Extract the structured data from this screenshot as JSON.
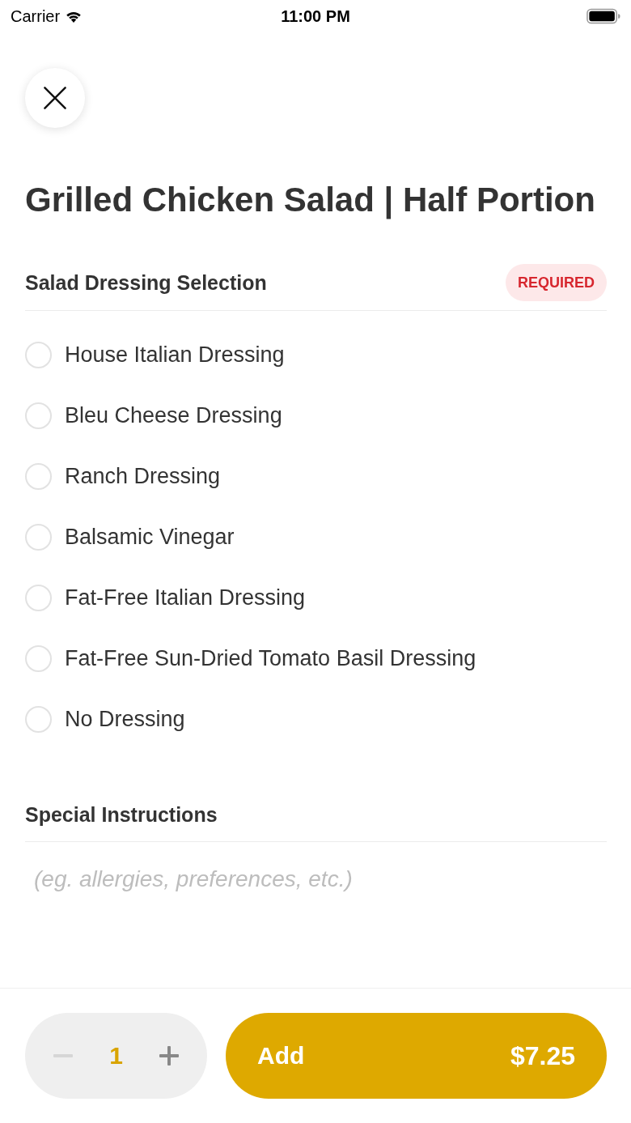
{
  "status_bar": {
    "carrier": "Carrier",
    "time": "11:00 PM"
  },
  "title": "Grilled Chicken Salad | Half Portion",
  "dressing_section": {
    "heading": "Salad Dressing Selection",
    "badge": "REQUIRED",
    "options": [
      {
        "label": "House Italian Dressing",
        "selected": false
      },
      {
        "label": "Bleu Cheese Dressing",
        "selected": false
      },
      {
        "label": "Ranch Dressing",
        "selected": false
      },
      {
        "label": "Balsamic Vinegar",
        "selected": false
      },
      {
        "label": "Fat-Free Italian Dressing",
        "selected": false
      },
      {
        "label": "Fat-Free Sun-Dried Tomato Basil Dressing",
        "selected": false
      },
      {
        "label": "No Dressing",
        "selected": false
      }
    ]
  },
  "instructions": {
    "heading": "Special Instructions",
    "placeholder": "(eg. allergies, preferences, etc.)"
  },
  "footer": {
    "quantity": {
      "value": "1",
      "decrement_disabled": true,
      "increment_disabled": false
    },
    "add_button": {
      "label": "Add",
      "price": "$7.25"
    }
  }
}
